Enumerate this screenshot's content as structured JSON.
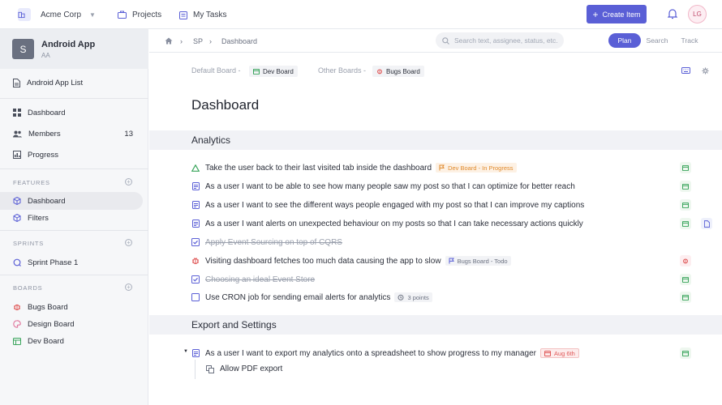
{
  "topbar": {
    "org_name": "Acme Corp",
    "projects_label": "Projects",
    "tasks_label": "My Tasks",
    "create_label": "Create Item",
    "avatar_initials": "LG"
  },
  "sidebar": {
    "project_initial": "S",
    "project_name": "Android App",
    "project_key": "AA",
    "list_label": "Android App List",
    "main": [
      {
        "label": "Dashboard",
        "icon": "grid-icon"
      },
      {
        "label": "Members",
        "icon": "people-icon",
        "count": "13"
      },
      {
        "label": "Progress",
        "icon": "chart-icon"
      }
    ],
    "features_heading": "FEATURES",
    "features": [
      {
        "label": "Dashboard",
        "icon": "cube-icon"
      },
      {
        "label": "Filters",
        "icon": "cube-icon"
      }
    ],
    "sprints_heading": "SPRINTS",
    "sprints": [
      {
        "label": "Sprint Phase 1",
        "icon": "sprint-icon"
      }
    ],
    "boards_heading": "BOARDS",
    "boards": [
      {
        "label": "Bugs Board",
        "color": "#e05a5a"
      },
      {
        "label": "Design Board",
        "color": "#e0739a"
      },
      {
        "label": "Dev Board",
        "color": "#3aa55c"
      }
    ]
  },
  "crumbs": {
    "project": "SP",
    "page": "Dashboard"
  },
  "search": {
    "placeholder": "Search text, assignee, status, etc."
  },
  "view_tabs": [
    "Plan",
    "Search",
    "Track"
  ],
  "active_tab": "Plan",
  "boards_line": {
    "default_label": "Default Board -",
    "default_board": "Dev Board",
    "other_label": "Other Boards -",
    "other_board": "Bugs Board"
  },
  "page_title": "Dashboard",
  "sections": [
    {
      "title": "Analytics",
      "tasks": [
        {
          "text": "Take the user back to their last visited tab inside the dashboard",
          "type": "epic",
          "tag": "Dev Board - In Progress",
          "done": false
        },
        {
          "text": "As a user I want to be able to see how many people saw my post so that I can optimize for better reach",
          "type": "story",
          "done": false
        },
        {
          "text": "As a user I want to see the different ways people engaged with my post so that I can improve my captions",
          "type": "story",
          "done": false
        },
        {
          "text": "As a user I want alerts on unexpected behaviour on my posts so that I can take necessary actions quickly",
          "type": "story",
          "done": false
        },
        {
          "text": "Apply Event Sourcing on top of CQRS",
          "type": "task",
          "done": true
        },
        {
          "text": "Visiting dashboard fetches too much data causing the app to slow",
          "type": "bug",
          "tag": "Bugs Board - Todo",
          "done": false
        },
        {
          "text": "Choosing an ideal Event Store",
          "type": "task",
          "done": true
        },
        {
          "text": "Use CRON job for sending email alerts for analytics",
          "type": "task-open",
          "tag": "3 points",
          "done": false
        }
      ]
    },
    {
      "title": "Export and Settings",
      "tasks": [
        {
          "text": "As a user I want to export my analytics onto a spreadsheet to show progress to my manager",
          "type": "story",
          "tag": "Aug 6th",
          "done": false
        }
      ],
      "subtask": "Allow PDF export"
    }
  ],
  "colors": {
    "accent": "#5a5fd6",
    "green": "#3aa55c",
    "orange": "#e08a2c",
    "red": "#e05a5a"
  }
}
